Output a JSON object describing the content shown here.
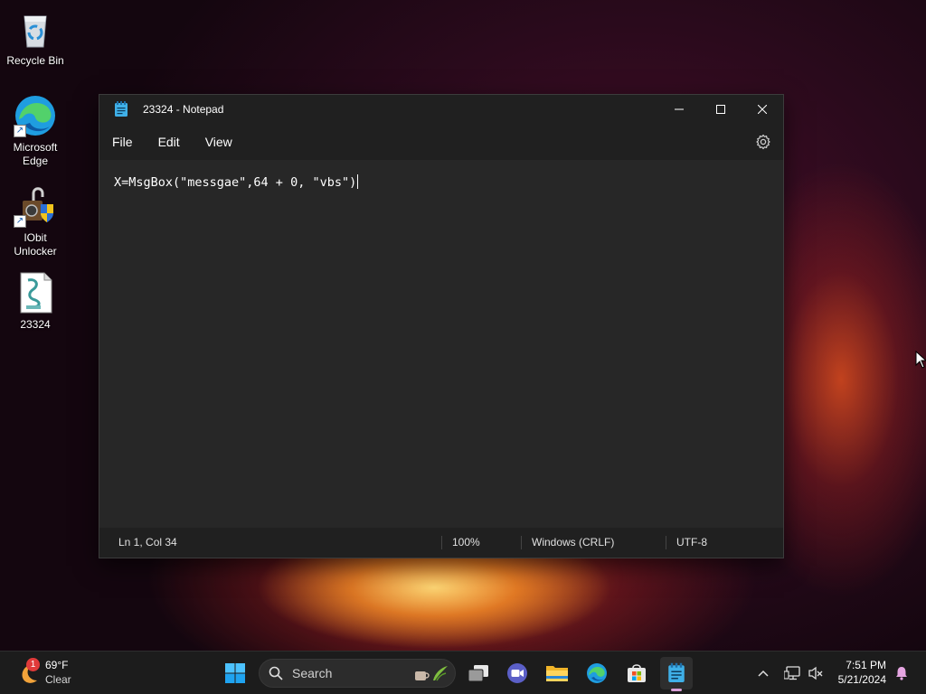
{
  "desktop": {
    "icons": [
      {
        "label": "Recycle Bin"
      },
      {
        "label": "Microsoft Edge"
      },
      {
        "label": "IObit Unlocker"
      },
      {
        "label": "23324"
      }
    ]
  },
  "notepad": {
    "title": "23324 - Notepad",
    "menu": [
      "File",
      "Edit",
      "View"
    ],
    "content": "X=MsgBox(\"messgae\",64 + 0, \"vbs\")",
    "status": {
      "position": "Ln 1, Col 34",
      "zoom": "100%",
      "line_ending": "Windows (CRLF)",
      "encoding": "UTF-8"
    }
  },
  "taskbar": {
    "weather": {
      "temp": "69°F",
      "condition": "Clear",
      "badge": "1"
    },
    "search_label": "Search",
    "clock": {
      "time": "7:51 PM",
      "date": "5/21/2024"
    },
    "apps": [
      "start",
      "task-view",
      "teams-meet",
      "file-explorer",
      "edge",
      "store",
      "notepad"
    ]
  },
  "colors": {
    "window_bg": "#272727",
    "titlebar_bg": "#202020",
    "taskbar_bg": "#1c1c1c",
    "accent": "#0078d4"
  }
}
